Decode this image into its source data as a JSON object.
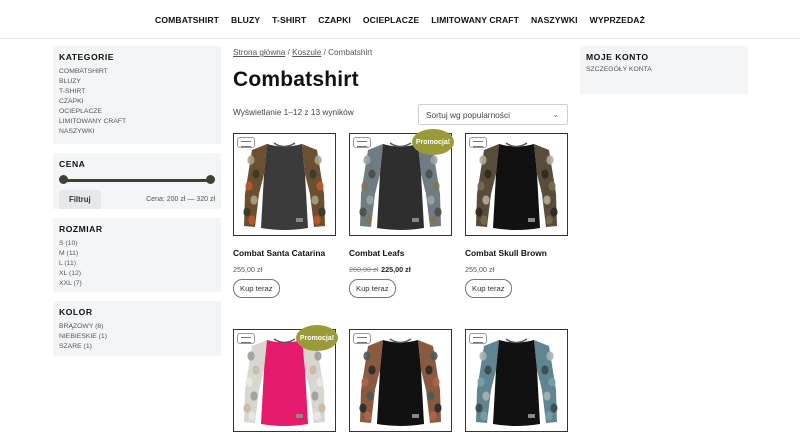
{
  "nav": {
    "items": [
      "COMBATSHIRT",
      "BLUZY",
      "T-SHIRT",
      "CZAPKI",
      "OCIEPLACZE",
      "LIMITOWANY CRAFT",
      "NASZYWKI",
      "WYPRZEDAŻ"
    ]
  },
  "sidebar": {
    "categories": {
      "title": "KATEGORIE",
      "items": [
        "COMBATSHIRT",
        "BLUZY",
        "T-SHIRT",
        "CZAPKI",
        "OCIEPLACZE",
        "LIMITOWANY CRAFT",
        "NASZYWKI"
      ]
    },
    "price": {
      "title": "CENA",
      "filter_label": "Filtruj",
      "range_label": "Cena: 200 zł — 320 zł",
      "min_fraction": 0,
      "max_fraction": 1
    },
    "size": {
      "title": "ROZMIAR",
      "items": [
        "S (10)",
        "M (11)",
        "L (11)",
        "XL (12)",
        "XXL (7)"
      ]
    },
    "color": {
      "title": "KOLOR",
      "items": [
        "BRĄZOWY (6)",
        "NIEBIESKIE (1)",
        "SZARE (1)"
      ]
    }
  },
  "breadcrumb": {
    "home": "Strona główna",
    "sep1": " / ",
    "parent": "Koszule",
    "sep2": " / ",
    "current": "Combatshirt"
  },
  "page": {
    "title": "Combatshirt",
    "results": "Wyświetlanie 1–12 z 13 wyników",
    "sort": "Sortuj wg popularności"
  },
  "products": [
    {
      "name": "Combat Santa Catarina",
      "price": "255,00 zł",
      "old_price": "",
      "new_price": "",
      "badge": "",
      "button": "Kup teraz",
      "body_color": "#3b3b3b",
      "sleeve_colors": [
        "#6b5030",
        "#a8a08a",
        "#3a3a2a",
        "#c2552c"
      ]
    },
    {
      "name": "Combat Leafs",
      "price": "",
      "old_price": "260,00 zł",
      "new_price": "225,00 zł",
      "badge": "Promocja!",
      "button": "Kup teraz",
      "body_color": "#2e2e2e",
      "sleeve_colors": [
        "#6f7c83",
        "#9aa3a2",
        "#4a4f4a",
        "#7d7658"
      ]
    },
    {
      "name": "Combat Skull Brown",
      "price": "255,00 zł",
      "old_price": "",
      "new_price": "",
      "badge": "",
      "button": "Kup teraz",
      "body_color": "#111111",
      "sleeve_colors": [
        "#5a4c3a",
        "#b3ab98",
        "#2a2a22",
        "#7a6a50"
      ]
    },
    {
      "name": "",
      "price": "",
      "old_price": "",
      "new_price": "",
      "badge": "Promocja!",
      "button": "",
      "body_color": "#e51a6b",
      "sleeve_colors": [
        "#d9d6cf",
        "#9c9c9c",
        "#c9b8a5",
        "#e8e8e8"
      ]
    },
    {
      "name": "",
      "price": "",
      "old_price": "",
      "new_price": "",
      "badge": "",
      "button": "",
      "body_color": "#111111",
      "sleeve_colors": [
        "#8a5a40",
        "#4a5a55",
        "#2a2a2a",
        "#b0664a"
      ]
    },
    {
      "name": "",
      "price": "",
      "old_price": "",
      "new_price": "",
      "badge": "",
      "button": "",
      "body_color": "#111111",
      "sleeve_colors": [
        "#5f8592",
        "#a6b4b0",
        "#3a4a4a",
        "#7aa0a6"
      ]
    }
  ],
  "account": {
    "title": "MOJE KONTO",
    "link": "SZCZEGÓŁY KONTA"
  }
}
